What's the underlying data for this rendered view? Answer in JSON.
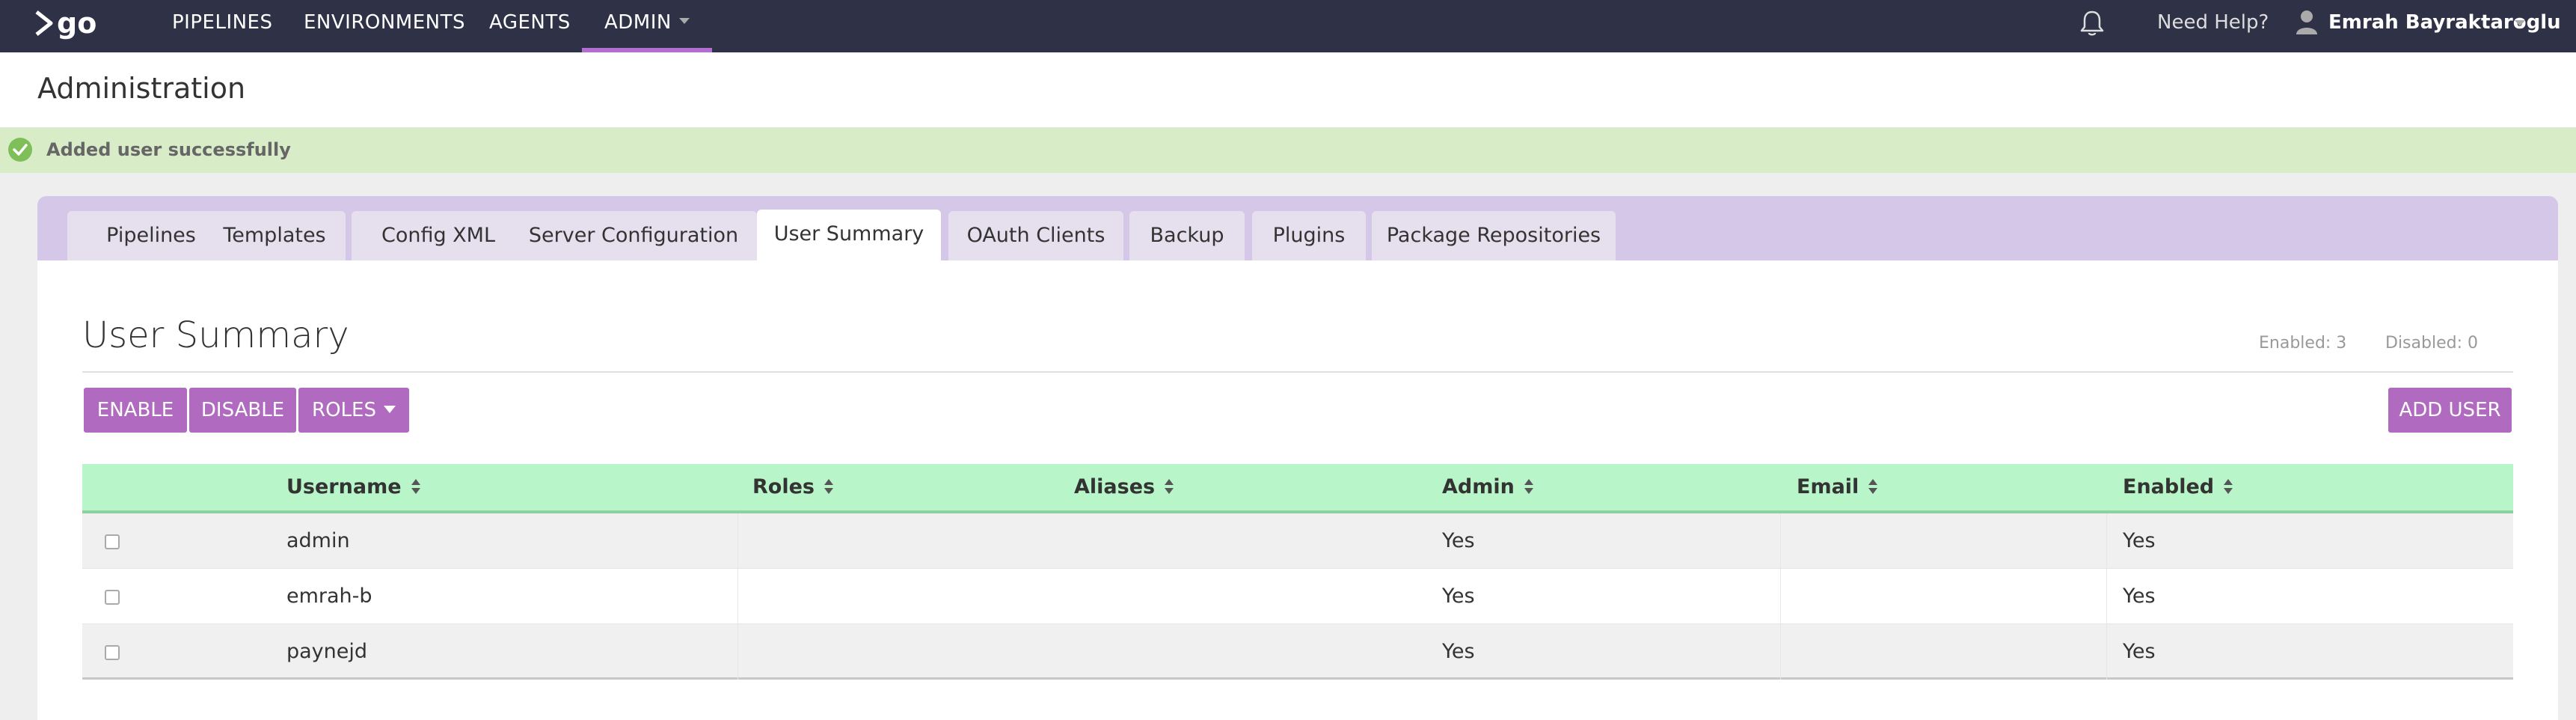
{
  "nav": {
    "logo_text": "go",
    "items": [
      {
        "label": "PIPELINES"
      },
      {
        "label": "ENVIRONMENTS"
      },
      {
        "label": "AGENTS"
      },
      {
        "label": "ADMIN"
      }
    ],
    "help_label": "Need Help?",
    "user_name": "Emrah Bayraktaroglu"
  },
  "header": {
    "title": "Administration"
  },
  "flash": {
    "message": "Added user successfully",
    "icon": "check-circle-icon"
  },
  "tabs": [
    {
      "label": "Pipelines"
    },
    {
      "label": "Templates"
    },
    {
      "label": "Config XML"
    },
    {
      "label": "Server Configuration"
    },
    {
      "label": "User Summary"
    },
    {
      "label": "OAuth Clients"
    },
    {
      "label": "Backup"
    },
    {
      "label": "Plugins"
    },
    {
      "label": "Package Repositories"
    }
  ],
  "summary": {
    "title": "User Summary",
    "enabled_stat": "Enabled: 3",
    "disabled_stat": "Disabled: 0"
  },
  "actions": {
    "enable_label": "ENABLE",
    "disable_label": "DISABLE",
    "roles_label": "ROLES",
    "add_user_label": "ADD USER"
  },
  "table": {
    "headers": [
      "Username",
      "Roles",
      "Aliases",
      "Admin",
      "Email",
      "Enabled"
    ],
    "rows": [
      {
        "username": "admin",
        "roles": "",
        "aliases": "",
        "admin": "Yes",
        "email": "",
        "enabled": "Yes"
      },
      {
        "username": "emrah-b",
        "roles": "",
        "aliases": "",
        "admin": "Yes",
        "email": "",
        "enabled": "Yes"
      },
      {
        "username": "paynejd",
        "roles": "",
        "aliases": "",
        "admin": "Yes",
        "email": "",
        "enabled": "Yes"
      }
    ]
  },
  "colors": {
    "nav_bg": "#2f3147",
    "accent": "#b06bc0",
    "flash_bg": "#d8ecc8",
    "tabbar_bg": "#d5c7e8",
    "table_header_bg": "#b8f5c8"
  }
}
